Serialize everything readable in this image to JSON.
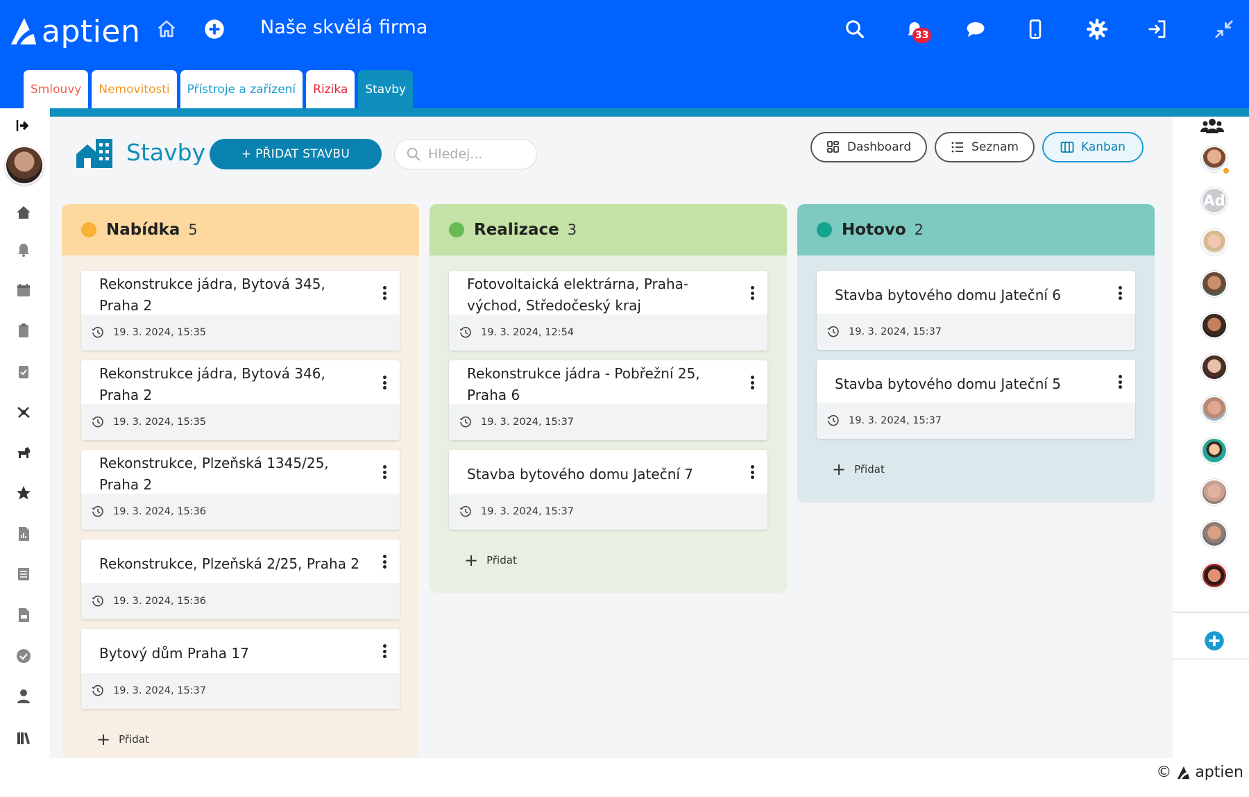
{
  "app": {
    "logo_text": "aptien",
    "company": "Naše skvělá firma",
    "notification_count": "33",
    "brand_color": "#0062ff",
    "accent_color": "#0f8fbd"
  },
  "tabs": [
    {
      "label": "Smlouvy",
      "color": "#f0604f"
    },
    {
      "label": "Nemovitosti",
      "color": "#f19a2b"
    },
    {
      "label": "Přístroje a zařízení",
      "color": "#1a9bd0"
    },
    {
      "label": "Rizika",
      "color": "#e8213a"
    },
    {
      "label": "Stavby",
      "color": "#ffffff"
    }
  ],
  "page": {
    "title": "Stavby",
    "add_label": "+ PŘIDAT STAVBU",
    "search_placeholder": "Hledej...",
    "views": [
      "Dashboard",
      "Seznam",
      "Kanban"
    ],
    "active_view": "Kanban"
  },
  "columns": [
    {
      "title": "Nabídka",
      "count": "5",
      "dot_color": "#f9b233",
      "head_color": "#fdd9a0",
      "body_color": "#f7efe4",
      "cards": [
        {
          "title": "Rekonstrukce jádra, Bytová 345, Praha 2",
          "date": "19. 3. 2024, 15:35"
        },
        {
          "title": "Rekonstrukce jádra, Bytová 346, Praha 2",
          "date": "19. 3. 2024, 15:35"
        },
        {
          "title": "Rekonstrukce, Plzeňská 1345/25, Praha 2",
          "date": "19. 3. 2024, 15:36"
        },
        {
          "title": "Rekonstrukce, Plzeňská 2/25, Praha 2",
          "date": "19. 3. 2024, 15:36"
        },
        {
          "title": "Bytový dům Praha 17",
          "date": "19. 3. 2024, 15:37"
        }
      ],
      "add_label": "Přidat"
    },
    {
      "title": "Realizace",
      "count": "3",
      "dot_color": "#66bb55",
      "head_color": "#c4e2a6",
      "body_color": "#e8f0e2",
      "cards": [
        {
          "title": "Fotovoltaická elektrárna, Praha-východ, Středočeský kraj",
          "date": "19. 3. 2024, 12:54"
        },
        {
          "title": "Rekonstrukce jádra - Pobřežní 25, Praha 6",
          "date": "19. 3. 2024, 15:37"
        },
        {
          "title": "Stavba bytového domu Jateční 7",
          "date": "19. 3. 2024, 15:37"
        }
      ],
      "add_label": "Přidat"
    },
    {
      "title": "Hotovo",
      "count": "2",
      "dot_color": "#14a38b",
      "head_color": "#7ccac0",
      "body_color": "#dbe9ec",
      "cards": [
        {
          "title": "Stavba bytového domu Jateční 6",
          "date": "19. 3. 2024, 15:37"
        },
        {
          "title": "Stavba bytového domu Jateční 5",
          "date": "19. 3. 2024, 15:37"
        }
      ],
      "add_label": "Přidat"
    }
  ],
  "right_sidebar": {
    "avatar_initials": "Ad"
  },
  "footer": {
    "copyright": "©",
    "brand": "aptien"
  }
}
